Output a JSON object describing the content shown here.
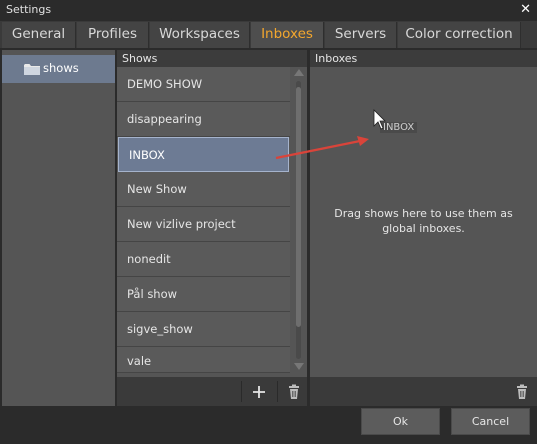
{
  "window": {
    "title": "Settings",
    "close_glyph": "✕"
  },
  "tabs": [
    {
      "label": "General"
    },
    {
      "label": "Profiles"
    },
    {
      "label": "Workspaces"
    },
    {
      "label": "Inboxes",
      "active": true
    },
    {
      "label": "Servers"
    },
    {
      "label": "Color correction"
    }
  ],
  "colors": {
    "active_tab": "#f3a72e",
    "selection": "#6d7b94",
    "drag_arrow": "#d9443a"
  },
  "tree": {
    "items": [
      {
        "label": "shows",
        "icon": "folder-icon"
      }
    ]
  },
  "shows_panel": {
    "header": "Shows",
    "items": [
      {
        "label": "DEMO SHOW"
      },
      {
        "label": "disappearing"
      },
      {
        "label": "INBOX",
        "selected": true
      },
      {
        "label": "New Show"
      },
      {
        "label": "New vizlive project"
      },
      {
        "label": "nonedit"
      },
      {
        "label": "Pål show"
      },
      {
        "label": "sigve_show"
      },
      {
        "label": "vale"
      }
    ],
    "add_glyph": "+",
    "add_icon": "plus-icon",
    "delete_icon": "trash-icon"
  },
  "inboxes_panel": {
    "header": "Inboxes",
    "hint": "Drag shows here to use them as global inboxes.",
    "drag_ghost": "INBOX",
    "delete_icon": "trash-icon"
  },
  "buttons": {
    "ok": "Ok",
    "cancel": "Cancel"
  }
}
